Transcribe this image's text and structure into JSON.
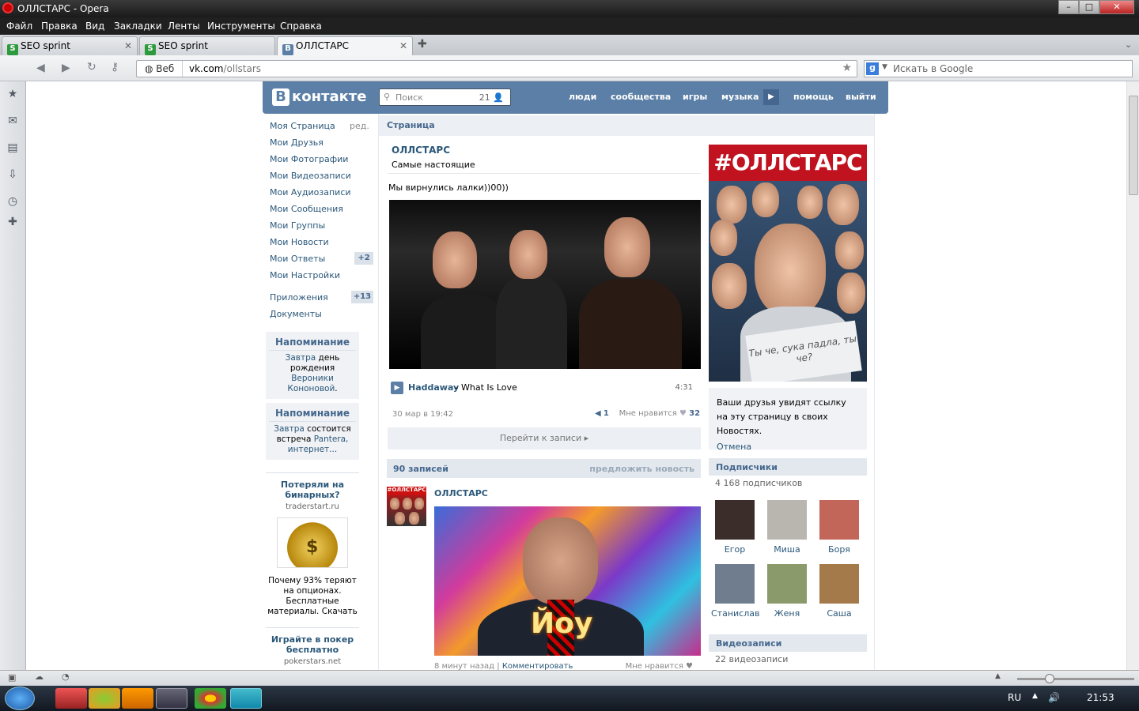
{
  "window": {
    "title": "ОЛЛСТАРС - Opera"
  },
  "menu": [
    "Файл",
    "Правка",
    "Вид",
    "Закладки",
    "Ленты",
    "Инструменты",
    "Справка"
  ],
  "tabs": [
    {
      "label": "SEO sprint",
      "fav": "S"
    },
    {
      "label": "SEO sprint",
      "fav": "S"
    },
    {
      "label": "ОЛЛСТАРС",
      "fav": "B"
    }
  ],
  "address": {
    "web_label": "Веб",
    "host": "vk.com",
    "path": "/ollstars"
  },
  "search": {
    "placeholder": "Искать в Google"
  },
  "vk": {
    "logo": "контакте",
    "logo_b": "B",
    "search_placeholder": "Поиск",
    "search_count": "21",
    "nav": [
      "люди",
      "сообщества",
      "игры",
      "музыка",
      "помощь",
      "выйти"
    ]
  },
  "left_nav": {
    "items": [
      {
        "label": "Моя Страница"
      },
      {
        "label": "Мои Друзья"
      },
      {
        "label": "Мои Фотографии"
      },
      {
        "label": "Мои Видеозаписи"
      },
      {
        "label": "Мои Аудиозаписи"
      },
      {
        "label": "Мои Сообщения"
      },
      {
        "label": "Мои Группы"
      },
      {
        "label": "Мои Новости"
      },
      {
        "label": "Мои Ответы"
      },
      {
        "label": "Мои Настройки"
      },
      {
        "label": "Приложения"
      },
      {
        "label": "Документы"
      }
    ],
    "edit": "ред.",
    "answers_badge": "+2",
    "apps_badge": "+13"
  },
  "reminders": [
    {
      "title": "Напоминание",
      "a1": "Завтра",
      "t1": " день рождения ",
      "a2": "Вероники Кононовой",
      "t2": "."
    },
    {
      "title": "Напоминание",
      "a1": "Завтра",
      "t1": " состоится встреча ",
      "a2": "Pantera, интернет...",
      "t2": ""
    }
  ],
  "ads": [
    {
      "title": "Потеряли на бинарных?",
      "domain": "traderstart.ru",
      "text": "Почему 93% теряют на опционах. Бесплатные материалы. Скачать"
    },
    {
      "title": "Играйте в покер бесплатно",
      "domain": "pokerstars.net"
    }
  ],
  "crumb": "Страница",
  "page": {
    "name": "ОЛЛСТАРС",
    "status": "Самые настоящие"
  },
  "pinned": {
    "text": "Мы вирнулись лалки))00))",
    "audio_artist": "Haddaway",
    "audio_title": "– What Is Love",
    "audio_duration": "4:31",
    "date": "30 мар в 19:42",
    "shares": "1",
    "like_label": "Мне нравится",
    "likes": "32",
    "goto": "Перейти к записи"
  },
  "wall": {
    "count": "90 записей",
    "suggest": "предложить новость"
  },
  "post2": {
    "name": "ОЛЛСТАРС",
    "ava_label": "#ОЛЛСТАРС",
    "img_text": "Йоу",
    "time": "8 минут назад",
    "comment": "Комментировать",
    "like_label": "Мне нравится"
  },
  "right": {
    "avatar_header": "#ОЛЛСТАРС",
    "paper_text": "Ты че, сука падла, ты че?",
    "share_text": "Ваши друзья увидят ссылку на эту страницу в своих Новостях.",
    "share_cancel": "Отмена",
    "subs_title": "Подписчики",
    "subs_count": "4 168 подписчиков",
    "friends": [
      {
        "name": "Егор",
        "color": "#3a2d2a"
      },
      {
        "name": "Миша",
        "color": "#b9b6b0"
      },
      {
        "name": "Боря",
        "color": "#c2665a"
      },
      {
        "name": "Станислав",
        "color": "#6f7d8f"
      },
      {
        "name": "Женя",
        "color": "#8a9a6b"
      },
      {
        "name": "Саша",
        "color": "#a57a4a"
      }
    ],
    "video_title": "Видеозаписи",
    "video_count": "22 видеозаписи"
  },
  "tray": {
    "lang": "RU",
    "time": "21:53"
  },
  "colors": {
    "vk_blue": "#5b7fa6",
    "link": "#2b587a",
    "panel": "#f0f2f5"
  }
}
